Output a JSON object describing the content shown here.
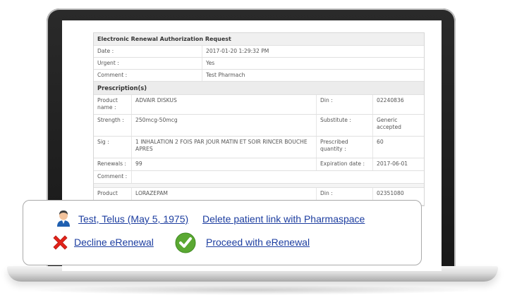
{
  "request": {
    "title": "Electronic Renewal Authorization Request",
    "fields": [
      {
        "label": "Date :",
        "value": "2017-01-20 1:29:32 PM"
      },
      {
        "label": "Urgent :",
        "value": "Yes"
      },
      {
        "label": "Comment :",
        "value": "Test Pharmach"
      }
    ]
  },
  "prescriptions": {
    "section_title": "Prescription(s)",
    "item1": {
      "product_label": "Product name :",
      "product_value": "ADVAIR DISKUS",
      "din_label": "Din :",
      "din_value": "02240836",
      "strength_label": "Strength :",
      "strength_value": "250mcg-50mcg",
      "substitute_label": "Substitute :",
      "substitute_value": "Generic accepted",
      "sig_label": "Sig :",
      "sig_value": "1 INHALATION 2 FOIS PAR JOUR MATIN ET SOIR RINCER BOUCHE APRES",
      "prescribed_qty_label": "Prescribed quantity :",
      "prescribed_qty_value": "60",
      "renewals_label": "Renewals :",
      "renewals_value": "99",
      "expiration_label": "Expiration date :",
      "expiration_value": "2017-06-01",
      "comment_label": "Comment :",
      "comment_value": ""
    },
    "item2": {
      "product_label": "Product",
      "product_value": "LORAZEPAM",
      "din_label": "Din :",
      "din_value": "02351080"
    }
  },
  "actions": {
    "patient_link": "Test, Telus (May 5, 1975)",
    "delete_link": "Delete patient link with Pharmaspace",
    "decline": "Decline eRenewal",
    "proceed": "Proceed with eRenewal"
  },
  "colors": {
    "link": "#1d3ea0",
    "decline_icon": "#e2231a",
    "proceed_icon": "#5aa832"
  },
  "icons": [
    "user-icon",
    "red-x-icon",
    "green-check-icon"
  ]
}
